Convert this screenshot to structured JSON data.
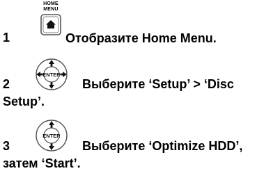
{
  "step1": {
    "number": "1",
    "button_label_line1": "HOME",
    "button_label_line2": "MENU",
    "text": "Отобразите Home Menu.",
    "icon": "home-menu-button-icon"
  },
  "step2": {
    "number": "2",
    "text_line1": "Выберите ‘Setup’ > ‘Disc",
    "text_line2": "Setup’.",
    "button_label": "ENTER",
    "icon": "enter-four-way-button-icon"
  },
  "step3": {
    "number": "3",
    "text_line1": "Выберите ‘Optimize HDD’,",
    "text_line2": "затем ‘Start’.",
    "button_label": "ENTER",
    "icon": "enter-up-down-button-icon"
  }
}
